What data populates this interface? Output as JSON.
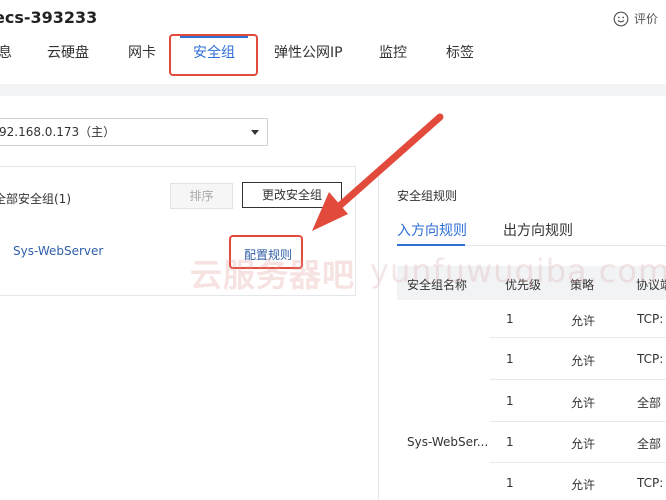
{
  "header": {
    "title": "ecs-393233",
    "feedback_label": "评价",
    "feedback_icon": "smile-icon"
  },
  "tabs": [
    {
      "label": "息"
    },
    {
      "label": "云硬盘"
    },
    {
      "label": "网卡"
    },
    {
      "label": "安全组",
      "active": true
    },
    {
      "label": "弹性公网IP"
    },
    {
      "label": "监控"
    },
    {
      "label": "标签"
    }
  ],
  "nic_select": {
    "value": "92.168.0.173（主）"
  },
  "security_groups": {
    "header_label": "全部安全组(1)",
    "sort_button": "排序",
    "change_button": "更改安全组",
    "items": [
      {
        "name": "Sys-WebServer",
        "action": "配置规则"
      }
    ]
  },
  "rules": {
    "title": "安全组规则",
    "tabs": [
      "入方向规则",
      "出方向规则"
    ],
    "columns": [
      "安全组名称",
      "优先级",
      "策略",
      "协议端"
    ],
    "group_name": "Sys-WebSer...",
    "rows": [
      {
        "priority": "1",
        "policy": "允许",
        "protocol": "TCP:"
      },
      {
        "priority": "1",
        "policy": "允许",
        "protocol": "TCP:"
      },
      {
        "priority": "1",
        "policy": "允许",
        "protocol": "全部"
      },
      {
        "priority": "1",
        "policy": "允许",
        "protocol": "全部"
      },
      {
        "priority": "1",
        "policy": "允许",
        "protocol": "TCP:"
      }
    ]
  },
  "watermark": {
    "cn": "云服务器吧",
    "latin": "yunfuwuqiba.com"
  },
  "colors": {
    "accent": "#2f6fd6",
    "highlight": "#e24a3b",
    "link": "#2f5fa8"
  }
}
